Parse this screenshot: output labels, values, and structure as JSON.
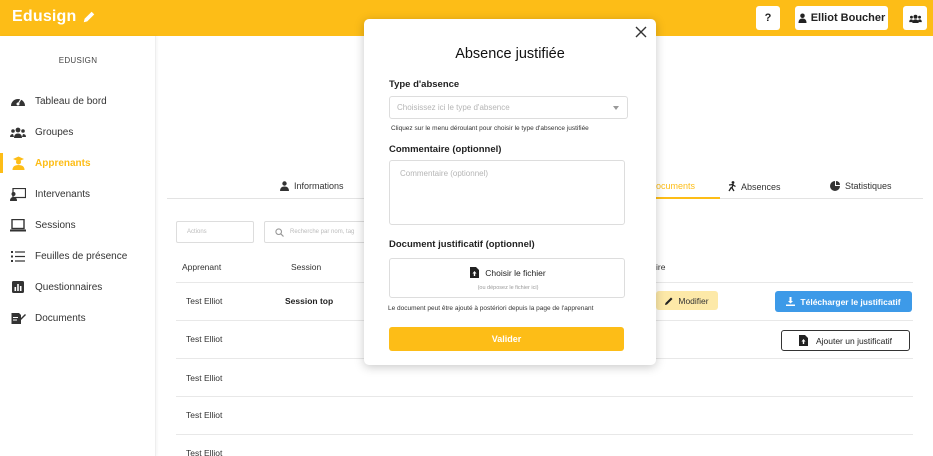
{
  "topbar": {
    "logo": "Edusign",
    "help_label": "?",
    "user_name": "Elliot Boucher"
  },
  "sidebar": {
    "title": "EDUSIGN",
    "items": [
      {
        "label": "Tableau de bord",
        "icon": "dashboard-icon"
      },
      {
        "label": "Groupes",
        "icon": "groups-icon"
      },
      {
        "label": "Apprenants",
        "icon": "student-icon",
        "active": true
      },
      {
        "label": "Intervenants",
        "icon": "teacher-icon"
      },
      {
        "label": "Sessions",
        "icon": "laptop-icon"
      },
      {
        "label": "Feuilles de présence",
        "icon": "list-icon"
      },
      {
        "label": "Questionnaires",
        "icon": "chart-icon"
      },
      {
        "label": "Documents",
        "icon": "document-icon"
      }
    ]
  },
  "main": {
    "tabs": [
      {
        "label": "Informations",
        "icon": "user-badge-icon"
      },
      {
        "label": "ocuments",
        "icon": "document-icon",
        "active": true
      },
      {
        "label": "Absences",
        "icon": "running-icon"
      },
      {
        "label": "Statistiques",
        "icon": "pie-chart-icon"
      }
    ],
    "filter_actions": "Actions",
    "search_placeholder": "Recherche par nom, tag",
    "columns": {
      "apprenant": "Apprenant",
      "session": "Session",
      "ire": "ire"
    },
    "rows": [
      {
        "apprenant": "Test Elliot",
        "session": "Session top"
      },
      {
        "apprenant": "Test Elliot",
        "session": ""
      },
      {
        "apprenant": "Test Elliot",
        "session": ""
      },
      {
        "apprenant": "Test Elliot",
        "session": ""
      },
      {
        "apprenant": "Test Elliot",
        "session": ""
      }
    ],
    "modifier_label": "Modifier",
    "download_label": "Télécharger le justificatif",
    "add_label": "Ajouter un justificatif"
  },
  "modal": {
    "title": "Absence justifiée",
    "type_label": "Type d'absence",
    "type_placeholder": "Choisissez ici le type d'absence",
    "type_hint": "Cliquez sur le menu déroulant pour choisir le type d'absence justifiée",
    "comment_label": "Commentaire (optionnel)",
    "comment_placeholder": "Commentaire (optionnel)",
    "document_label": "Document justificatif (optionnel)",
    "file_label": "Choisir le fichier",
    "file_sub": "(ou déposez le fichier ici)",
    "document_hint": "Le document peut être ajouté à postériori depuis la page de l'apprenant",
    "submit_label": "Valider"
  },
  "colors": {
    "brand": "#fdbd17",
    "primary_blue": "#3d9ae8",
    "modifier_bg": "#fde9a8"
  }
}
